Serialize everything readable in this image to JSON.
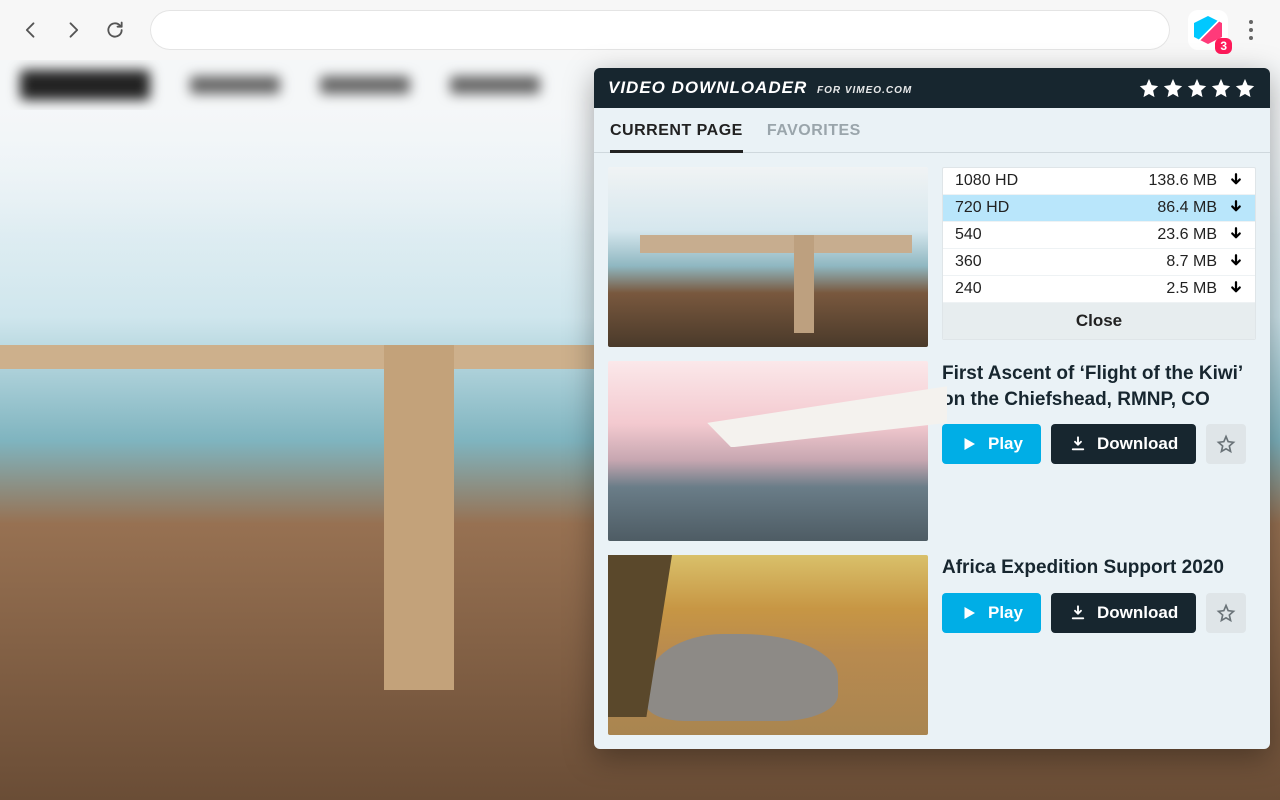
{
  "browser": {
    "extension_badge": "3"
  },
  "popup": {
    "title_main": "VIDEO DOWNLOADER",
    "title_sub": "FOR VIMEO.COM",
    "tabs": {
      "current": "CURRENT PAGE",
      "favorites": "FAVORITES"
    },
    "buttons": {
      "play": "Play",
      "download": "Download",
      "close": "Close"
    }
  },
  "videos": [
    {
      "expanded": true,
      "qualities": [
        {
          "label": "1080 HD",
          "size": "138.6 MB",
          "selected": false
        },
        {
          "label": "720 HD",
          "size": "86.4 MB",
          "selected": true
        },
        {
          "label": "540",
          "size": "23.6 MB",
          "selected": false
        },
        {
          "label": "360",
          "size": "8.7 MB",
          "selected": false
        },
        {
          "label": "240",
          "size": "2.5 MB",
          "selected": false
        }
      ]
    },
    {
      "title": "First Ascent of ‘Flight of the Kiwi’ on the Chiefshead, RMNP, CO"
    },
    {
      "title": "Africa Expedition Support 2020"
    }
  ]
}
